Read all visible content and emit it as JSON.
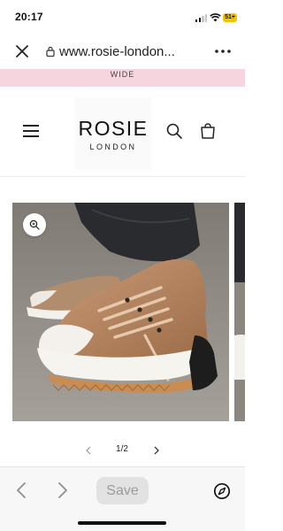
{
  "status_bar": {
    "time": "20:17",
    "battery": "51+"
  },
  "browser": {
    "url": "www.rosie-london..."
  },
  "announcement": {
    "text": "WIDE"
  },
  "header": {
    "logo_main": "ROSIE",
    "logo_sub": "LONDON"
  },
  "gallery": {
    "image_subject": "tan lace-up platform sneaker",
    "pagination": "1/2"
  },
  "toolbar": {
    "save_label": "Save"
  },
  "icons": {
    "close": "close-icon",
    "lock": "lock-icon",
    "more": "more-icon",
    "menu": "hamburger-icon",
    "search": "search-icon",
    "cart": "bag-icon",
    "zoom": "zoom-icon",
    "back": "chevron-left-icon",
    "forward": "chevron-right-icon",
    "compass": "compass-icon"
  },
  "colors": {
    "announcement_bg": "#f6d5df",
    "battery": "#f5c400"
  }
}
